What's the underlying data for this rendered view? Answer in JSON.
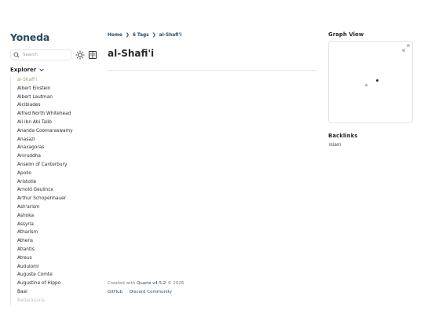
{
  "site": {
    "title": "Yoneda"
  },
  "search": {
    "placeholder": "Search"
  },
  "explorer": {
    "label": "Explorer",
    "items": [
      "al-Shafi'i",
      "Albert Einstein",
      "Albert Lautman",
      "Alcibiades",
      "Alfred North Whitehead",
      "Ali ibn Abi Talib",
      "Ananda Coomaraswamy",
      "Anasazi",
      "Anaxagoras",
      "Aniruddha",
      "Anselm of Canterbury",
      "Apollo",
      "Aristotle",
      "Arnold Geulincx",
      "Arthur Schopenhauer",
      "Ash'arism",
      "Ashoka",
      "Assyria",
      "Atharism",
      "Athens",
      "Atlantis",
      "Atreus",
      "Audulomi",
      "Auguste Comte",
      "Augustine of Hippo",
      "Baal",
      "Badarayana"
    ]
  },
  "breadcrumb": {
    "home": "Home",
    "tags": "6 Tags",
    "current": "al-Shafi'i"
  },
  "article": {
    "title": "al-Shafi'i"
  },
  "footer": {
    "created_prefix": "Created with",
    "quartz_link": "Quartz v4.5.2",
    "copyright": "© 2026",
    "links": [
      "GitHub",
      "Discord Community"
    ]
  },
  "graph": {
    "title": "Graph View"
  },
  "backlinks": {
    "title": "Backlinks",
    "items": [
      "Islam"
    ]
  },
  "colors": {
    "accent": "#284b63",
    "active_item": "#9aa06d",
    "border": "#e5e5e5"
  },
  "icons": [
    "search-icon",
    "sun-icon",
    "book-icon",
    "chevron-down-icon",
    "expand-icon"
  ]
}
